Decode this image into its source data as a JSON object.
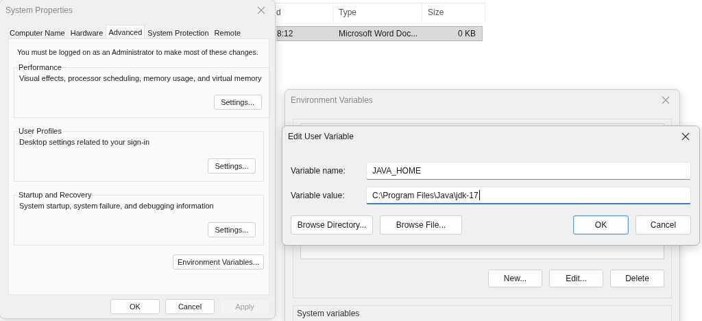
{
  "file_list": {
    "columns": [
      "d",
      "Type",
      "Size"
    ],
    "rows": [
      {
        "cells": [
          "8:12",
          "Microsoft Word Doc...",
          "0 KB"
        ],
        "selected": true
      }
    ]
  },
  "system_properties": {
    "title": "System Properties",
    "tabs": [
      {
        "label": "Computer Name",
        "selected": false
      },
      {
        "label": "Hardware",
        "selected": false
      },
      {
        "label": "Advanced",
        "selected": true
      },
      {
        "label": "System Protection",
        "selected": false
      },
      {
        "label": "Remote",
        "selected": false
      }
    ],
    "notice": "You must be logged on as an Administrator to make most of these changes.",
    "groups": [
      {
        "title": "Performance",
        "description": "Visual effects, processor scheduling, memory usage, and virtual memory",
        "button": "Settings..."
      },
      {
        "title": "User Profiles",
        "description": "Desktop settings related to your sign-in",
        "button": "Settings..."
      },
      {
        "title": "Startup and Recovery",
        "description": "System startup, system failure, and debugging information",
        "button": "Settings..."
      }
    ],
    "environment_button": "Environment Variables...",
    "buttons": [
      {
        "label": "OK",
        "disabled": false
      },
      {
        "label": "Cancel",
        "disabled": false
      },
      {
        "label": "Apply",
        "disabled": true
      }
    ]
  },
  "environment_variables": {
    "title": "Environment Variables",
    "buttons": [
      "New...",
      "Edit...",
      "Delete"
    ],
    "system_variables_label": "System variables"
  },
  "edit_dialog": {
    "title": "Edit User Variable",
    "fields": [
      {
        "label": "Variable name:",
        "value": "JAVA_HOME",
        "focused": false
      },
      {
        "label": "Variable value:",
        "value": "C:\\Program Files\\Java\\jdk-17",
        "focused": true
      }
    ],
    "left_buttons": [
      {
        "label": "Browse Directory...",
        "default": false
      },
      {
        "label": "Browse File...",
        "default": false
      }
    ],
    "right_buttons": [
      {
        "label": "OK",
        "default": true
      },
      {
        "label": "Cancel",
        "default": false
      }
    ]
  }
}
